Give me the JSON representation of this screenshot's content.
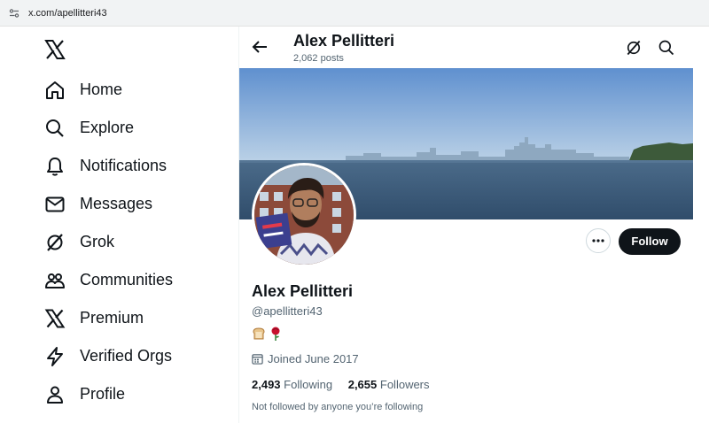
{
  "browser": {
    "url": "x.com/apellitteri43"
  },
  "nav": {
    "items": [
      {
        "label": "Home",
        "icon": "home-icon"
      },
      {
        "label": "Explore",
        "icon": "search-icon"
      },
      {
        "label": "Notifications",
        "icon": "bell-icon"
      },
      {
        "label": "Messages",
        "icon": "envelope-icon"
      },
      {
        "label": "Grok",
        "icon": "grok-icon"
      },
      {
        "label": "Communities",
        "icon": "people-icon"
      },
      {
        "label": "Premium",
        "icon": "x-logo-icon"
      },
      {
        "label": "Verified Orgs",
        "icon": "lightning-icon"
      },
      {
        "label": "Profile",
        "icon": "person-icon"
      }
    ]
  },
  "header": {
    "title": "Alex Pellitteri",
    "posts": "2,062 posts"
  },
  "profile": {
    "name": "Alex Pellitteri",
    "handle": "@apellitteri43",
    "bio_emojis": "bread, rose",
    "joined": "Joined June 2017",
    "following_count": "2,493",
    "following_label": "Following",
    "followers_count": "2,655",
    "followers_label": "Followers",
    "not_followed": "Not followed by anyone you’re following",
    "follow_label": "Follow"
  },
  "colors": {
    "text": "#0f1419",
    "secondary": "#536471",
    "sky": "#a9c6e6",
    "water": "#3e5c79"
  }
}
